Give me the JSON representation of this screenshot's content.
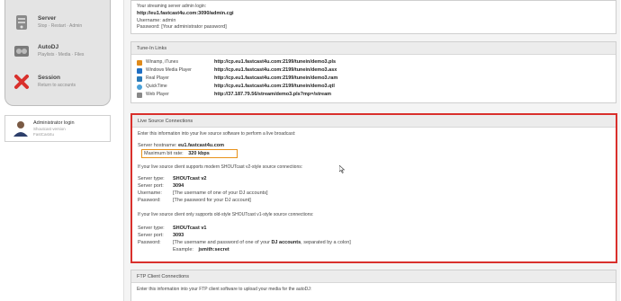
{
  "sidebar": {
    "items": [
      {
        "title": "Server",
        "subtitle": "Stop · Restart · Admin",
        "icon": "server-icon"
      },
      {
        "title": "AutoDJ",
        "subtitle": "Playlists · Media · Files",
        "icon": "autodj-icon"
      },
      {
        "title": "Session",
        "subtitle": "Return to accounts",
        "icon": "close-icon"
      }
    ]
  },
  "admin": {
    "title": "Administrator login",
    "line1": "Shoutcast version",
    "line2": "FastCast4u",
    "icon": "user-icon"
  },
  "top_panel": {
    "line1": "Your streaming server admin login:",
    "url": "http://eu1.fastcast4u.com:3090/admin.cgi",
    "username": "Username: admin",
    "password": "Password: [Your administrator password]"
  },
  "tunein": {
    "title": "Tune-In Links",
    "rows": [
      {
        "name": "Winamp, iTunes",
        "url": "http://cp.eu1.fastcast4u.com:2199/tunein/demo3.pls",
        "icon": "winamp-icon",
        "color": "#e08a1a"
      },
      {
        "name": "Windows Media Player",
        "url": "http://cp.eu1.fastcast4u.com:2199/tunein/demo3.asx",
        "icon": "wmp-icon",
        "color": "#1f6fc4"
      },
      {
        "name": "Real Player",
        "url": "http://cp.eu1.fastcast4u.com:2199/tunein/demo3.ram",
        "icon": "realplayer-icon",
        "color": "#2a7ab8"
      },
      {
        "name": "QuickTime",
        "url": "http://cp.eu1.fastcast4u.com:2199/tunein/demo3.qtl",
        "icon": "quicktime-icon",
        "color": "#4aa0d8"
      },
      {
        "name": "Web Player",
        "url": "http://37.187.79.56/stream/demo3.pls?mp=/stream",
        "icon": "webplayer-icon",
        "color": "#888888"
      }
    ]
  },
  "live": {
    "title": "Live Source Connections",
    "intro": "Enter this information into your live source software to perform a live broadcast:",
    "host_label": "Server hostname:",
    "host_value": "eu1.fastcast4u.com",
    "bitrate_label": "Maximum bit rate:",
    "bitrate_value": "320 kbps",
    "v2_intro": "If your live source client supports modern SHOUTcast v2-style source connections:",
    "v2": {
      "type_label": "Server type:",
      "type_value": "SHOUTcast v2",
      "port_label": "Server port:",
      "port_value": "3094",
      "user_label": "Username:",
      "user_value": "[The username of one of your DJ accounts]",
      "pass_label": "Password:",
      "pass_value": "[The password for your DJ account]"
    },
    "v1_intro": "If your live source client only supports old-style SHOUTcast v1-style source connections:",
    "v1": {
      "type_label": "Server type:",
      "type_value": "SHOUTcast v1",
      "port_label": "Server port:",
      "port_value": "3093",
      "pass_label": "Password:",
      "pass_value_a": "[The username and password of one of your ",
      "pass_value_b": "DJ accounts",
      "pass_value_c": ", separated by a colon]",
      "example_label": "Example:",
      "example_value": "jsmith:secret"
    }
  },
  "ftp": {
    "title": "FTP Client Connections",
    "intro": "Enter this information into your FTP client software to upload your media for the autoDJ:"
  },
  "colors": {
    "highlight_red": "#d9302c",
    "highlight_orange": "#e8921a"
  }
}
